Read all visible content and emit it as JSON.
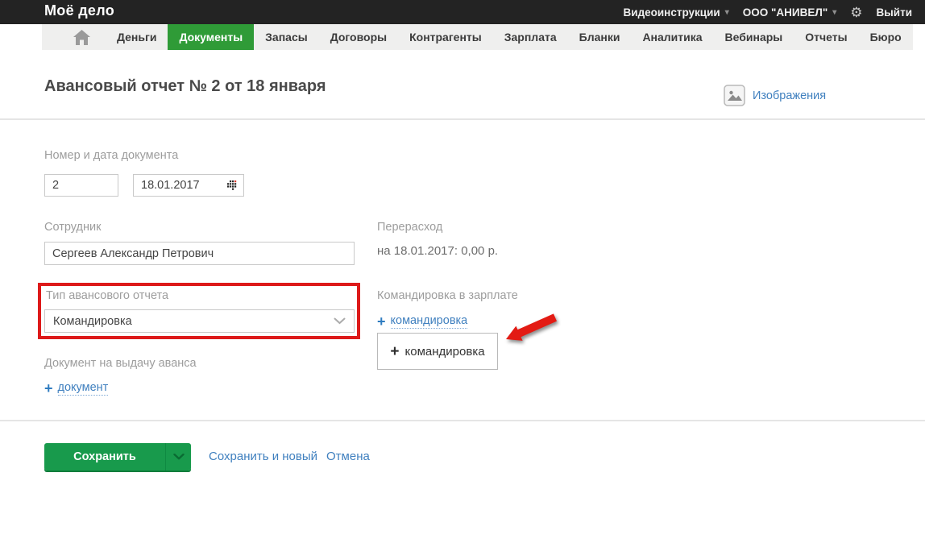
{
  "topbar": {
    "logo": "Моё дело",
    "video_link": "Видеоинструкции",
    "company": "ООО \"АНИВЕЛ\"",
    "logout": "Выйти"
  },
  "nav": {
    "items": [
      {
        "label": "Деньги",
        "active": false
      },
      {
        "label": "Документы",
        "active": true
      },
      {
        "label": "Запасы",
        "active": false
      },
      {
        "label": "Договоры",
        "active": false
      },
      {
        "label": "Контрагенты",
        "active": false
      },
      {
        "label": "Зарплата",
        "active": false
      },
      {
        "label": "Бланки",
        "active": false
      },
      {
        "label": "Аналитика",
        "active": false
      },
      {
        "label": "Вебинары",
        "active": false
      },
      {
        "label": "Отчеты",
        "active": false
      },
      {
        "label": "Бюро",
        "active": false
      }
    ]
  },
  "page": {
    "title": "Авансовый отчет № 2 от 18 января",
    "images_link": "Изображения"
  },
  "form": {
    "number_date": {
      "label": "Номер и дата документа",
      "number_value": "2",
      "date_value": "18.01.2017"
    },
    "employee": {
      "label": "Сотрудник",
      "value": "Сергеев Александр Петрович"
    },
    "overspend": {
      "label": "Перерасход",
      "value": "на 18.01.2017: 0,00 р."
    },
    "report_type": {
      "label": "Тип авансового отчета",
      "value": "Командировка"
    },
    "trip_in_salary": {
      "label": "Командировка в зарплате",
      "add_link": "командировка",
      "add_button": "командировка"
    },
    "advance_doc": {
      "label": "Документ на выдачу аванса",
      "add_link": "документ"
    }
  },
  "footer": {
    "save": "Сохранить",
    "save_and_new": "Сохранить и новый",
    "cancel": "Отмена"
  },
  "icons": {
    "plus": "+",
    "caret_down": "▾",
    "gear": "⚙"
  },
  "colors": {
    "topbar_bg": "#232323",
    "nav_bg": "#efefee",
    "active_tab_green": "#2f9b37",
    "save_button_green": "#189a4c",
    "link_blue": "#4080bf",
    "annotation_red": "#dd1a1a",
    "label_gray": "#9d9d9d"
  }
}
